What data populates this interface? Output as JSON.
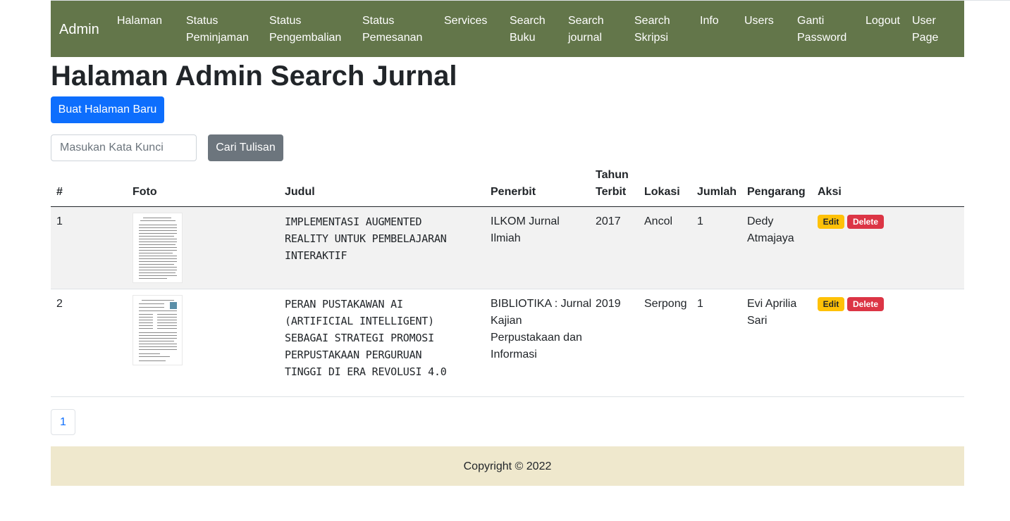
{
  "navbar": {
    "brand": "Admin",
    "links": [
      {
        "line1": "Halaman",
        "line2": ""
      },
      {
        "line1": "Status",
        "line2": "Peminjaman"
      },
      {
        "line1": "Status",
        "line2": "Pengembalian"
      },
      {
        "line1": "Status",
        "line2": "Pemesanan"
      },
      {
        "line1": "Services",
        "line2": ""
      },
      {
        "line1": "Search",
        "line2": "Buku"
      },
      {
        "line1": "Search",
        "line2": "journal"
      },
      {
        "line1": "Search",
        "line2": "Skripsi"
      },
      {
        "line1": "Info",
        "line2": ""
      },
      {
        "line1": "Users",
        "line2": ""
      },
      {
        "line1": "Ganti",
        "line2": "Password"
      },
      {
        "line1": "Logout",
        "line2": ""
      },
      {
        "line1": "User",
        "line2": "Page"
      }
    ],
    "color": "#63764a"
  },
  "page_title": "Halaman Admin Search Jurnal",
  "create_button": "Buat Halaman Baru",
  "search": {
    "placeholder": "Masukan Kata Kunci",
    "value": "",
    "button": "Cari Tulisan"
  },
  "table": {
    "headers": {
      "no": "#",
      "foto": "Foto",
      "judul": "Judul",
      "penerbit": "Penerbit",
      "tahun_line1": "Tahun",
      "tahun_line2": "Terbit",
      "lokasi": "Lokasi",
      "jumlah": "Jumlah",
      "pengarang": "Pengarang",
      "aksi": "Aksi"
    },
    "rows": [
      {
        "no": "1",
        "judul": [
          "IMPLEMENTASI AUGMENTED",
          "REALITY UNTUK PEMBELAJARAN",
          "INTERAKTIF"
        ],
        "penerbit": [
          "ILKOM Jurnal",
          "Ilmiah"
        ],
        "tahun": "2017",
        "lokasi": "Ancol",
        "jumlah": "1",
        "pengarang": [
          "Dedy",
          "Atmajaya"
        ],
        "edit": "Edit",
        "delete": "Delete"
      },
      {
        "no": "2",
        "judul": [
          "PERAN PUSTAKAWAN AI",
          "(ARTIFICIAL INTELLIGENT)",
          "SEBAGAI STRATEGI PROMOSI",
          "PERPUSTAKAAN PERGURUAN",
          "TINGGI DI ERA REVOLUSI 4.0"
        ],
        "penerbit": [
          "BIBLIOTIKA : Jurnal",
          "Kajian",
          "Perpustakaan dan",
          "Informasi"
        ],
        "tahun": "2019",
        "lokasi": "Serpong",
        "jumlah": "1",
        "pengarang": [
          "Evi Aprilia",
          "Sari"
        ],
        "edit": "Edit",
        "delete": "Delete"
      }
    ]
  },
  "pagination": {
    "current_page": "1"
  },
  "footer": {
    "text": "Copyright © 2022",
    "color": "#efe8cd"
  }
}
